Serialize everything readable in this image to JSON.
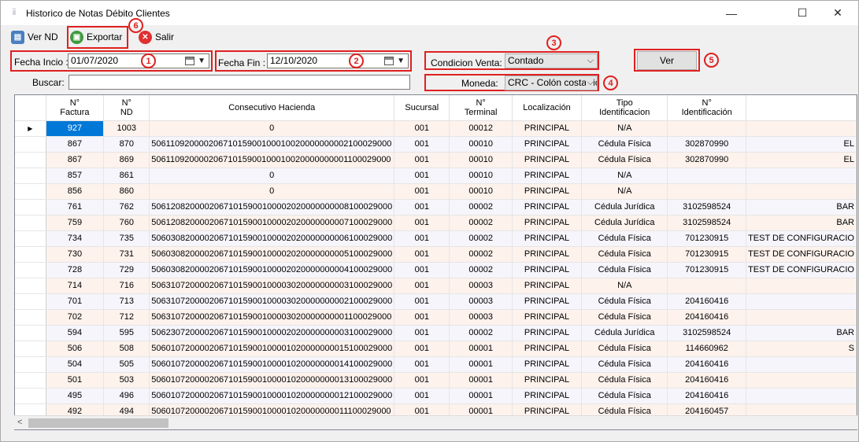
{
  "window": {
    "title": "Historico de Notas Débito Clientes",
    "minimize": "—",
    "maximize": "☐",
    "close": "✕"
  },
  "toolbar": {
    "ver_nd": "Ver ND",
    "exportar": "Exportar",
    "salir": "Salir"
  },
  "markers": [
    "1",
    "2",
    "3",
    "4",
    "5",
    "6"
  ],
  "filters": {
    "fecha_inicio_label": "Fecha Incio :",
    "fecha_inicio_value": "01/07/2020",
    "fecha_fin_label": "Fecha Fin :",
    "fecha_fin_value": "12/10/2020",
    "condicion_label": "Condicion Venta:",
    "condicion_value": "Contado",
    "moneda_label": "Moneda:",
    "moneda_value": "CRC - Colón costarric",
    "buscar_label": "Buscar:",
    "buscar_value": "",
    "ver_button": "Ver"
  },
  "table": {
    "columns": [
      "",
      "N°\nFactura",
      "N°\nND",
      "Consecutivo Hacienda",
      "Sucursal",
      "N°\nTerminal",
      "Localización",
      "Tipo\nIdentificacion",
      "N°\nIdentificación",
      ""
    ],
    "rows": [
      [
        "927",
        "1003",
        "0",
        "001",
        "00012",
        "PRINCIPAL",
        "N/A",
        "",
        ""
      ],
      [
        "867",
        "870",
        "50611092000020671015900100010020000000002100029000",
        "001",
        "00010",
        "PRINCIPAL",
        "Cédula Física",
        "302870990",
        "EL"
      ],
      [
        "867",
        "869",
        "50611092000020671015900100010020000000001100029000",
        "001",
        "00010",
        "PRINCIPAL",
        "Cédula Física",
        "302870990",
        "EL"
      ],
      [
        "857",
        "861",
        "0",
        "001",
        "00010",
        "PRINCIPAL",
        "N/A",
        "",
        ""
      ],
      [
        "856",
        "860",
        "0",
        "001",
        "00010",
        "PRINCIPAL",
        "N/A",
        "",
        ""
      ],
      [
        "761",
        "762",
        "50612082000020671015900100002020000000008100029000",
        "001",
        "00002",
        "PRINCIPAL",
        "Cédula Jurídica",
        "3102598524",
        "BAR"
      ],
      [
        "759",
        "760",
        "50612082000020671015900100002020000000007100029000",
        "001",
        "00002",
        "PRINCIPAL",
        "Cédula Jurídica",
        "3102598524",
        "BAR"
      ],
      [
        "734",
        "735",
        "50603082000020671015900100002020000000006100029000",
        "001",
        "00002",
        "PRINCIPAL",
        "Cédula Física",
        "701230915",
        "TEST DE CONFIGURACIO"
      ],
      [
        "730",
        "731",
        "50603082000020671015900100002020000000005100029000",
        "001",
        "00002",
        "PRINCIPAL",
        "Cédula Física",
        "701230915",
        "TEST DE CONFIGURACIO"
      ],
      [
        "728",
        "729",
        "50603082000020671015900100002020000000004100029000",
        "001",
        "00002",
        "PRINCIPAL",
        "Cédula Física",
        "701230915",
        "TEST DE CONFIGURACIO"
      ],
      [
        "714",
        "716",
        "50631072000020671015900100003020000000003100029000",
        "001",
        "00003",
        "PRINCIPAL",
        "N/A",
        "",
        ""
      ],
      [
        "701",
        "713",
        "50631072000020671015900100003020000000002100029000",
        "001",
        "00003",
        "PRINCIPAL",
        "Cédula Física",
        "204160416",
        ""
      ],
      [
        "702",
        "712",
        "50631072000020671015900100003020000000001100029000",
        "001",
        "00003",
        "PRINCIPAL",
        "Cédula Física",
        "204160416",
        ""
      ],
      [
        "594",
        "595",
        "50623072000020671015900100002020000000003100029000",
        "001",
        "00002",
        "PRINCIPAL",
        "Cédula Jurídica",
        "3102598524",
        "BAR"
      ],
      [
        "506",
        "508",
        "50601072000020671015900100001020000000015100029000",
        "001",
        "00001",
        "PRINCIPAL",
        "Cédula Física",
        "114660962",
        "S"
      ],
      [
        "504",
        "505",
        "50601072000020671015900100001020000000014100029000",
        "001",
        "00001",
        "PRINCIPAL",
        "Cédula Física",
        "204160416",
        ""
      ],
      [
        "501",
        "503",
        "50601072000020671015900100001020000000013100029000",
        "001",
        "00001",
        "PRINCIPAL",
        "Cédula Física",
        "204160416",
        ""
      ],
      [
        "495",
        "496",
        "50601072000020671015900100001020000000012100029000",
        "001",
        "00001",
        "PRINCIPAL",
        "Cédula Física",
        "204160416",
        ""
      ],
      [
        "492",
        "494",
        "50601072000020671015900100001020000000011100029000",
        "001",
        "00001",
        "PRINCIPAL",
        "Cédula Física",
        "204160457",
        ""
      ]
    ]
  },
  "colors": {
    "accent": "#e02020",
    "selected": "#0078d7",
    "row_odd": "#fdf2ec",
    "row_even": "#f5f5fb"
  }
}
